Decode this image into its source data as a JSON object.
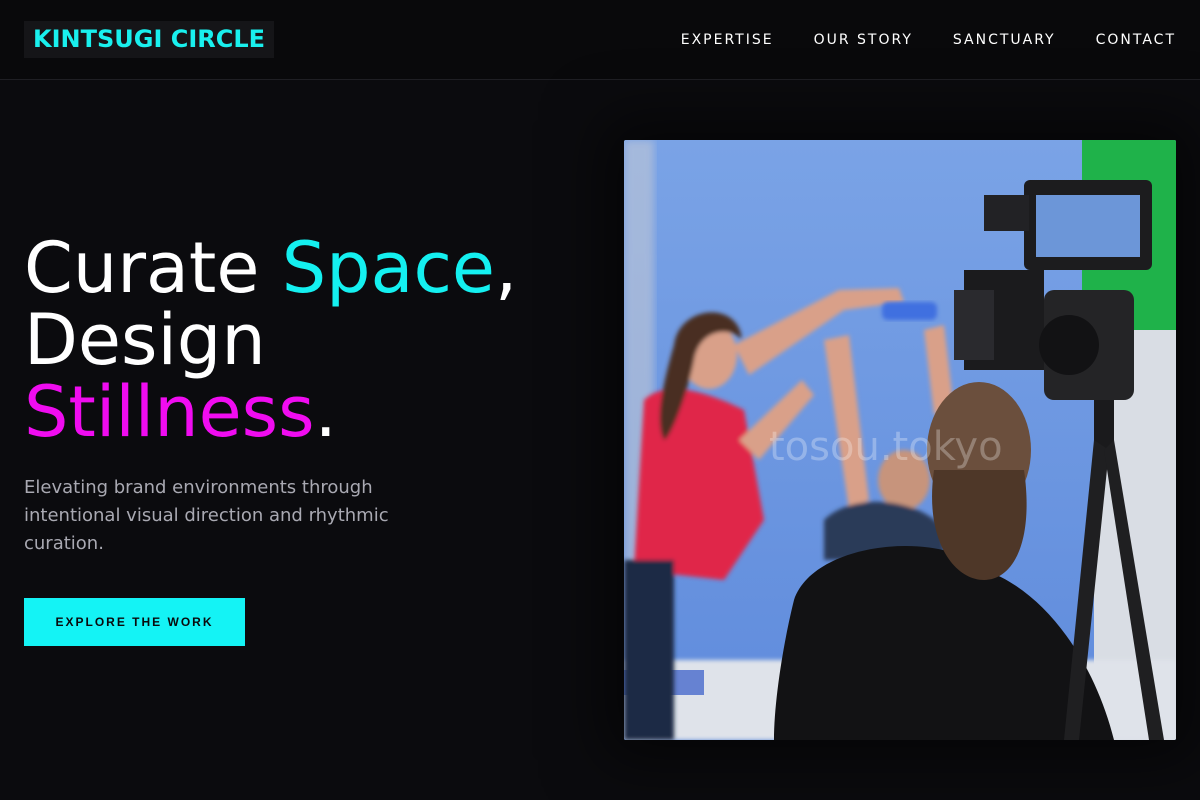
{
  "brand": {
    "name": "KINTSUGI CIRCLE"
  },
  "nav": {
    "items": [
      {
        "label": "EXPERTISE"
      },
      {
        "label": "OUR STORY"
      },
      {
        "label": "SANCTUARY"
      },
      {
        "label": "CONTACT"
      }
    ]
  },
  "hero": {
    "title_part1": "Curate ",
    "title_accent1": "Space",
    "title_part2": ",",
    "title_line2": "Design",
    "title_accent2": "Stillness",
    "title_end": ".",
    "subtitle": "Elevating brand environments through intentional visual direction and rhythmic curation.",
    "cta_label": "EXPLORE THE WORK"
  },
  "photo": {
    "watermark": "tosou.tokyo"
  },
  "colors": {
    "accent_cyan": "#14f0f0",
    "accent_magenta": "#f00cf0",
    "background": "#0b0b0e"
  }
}
